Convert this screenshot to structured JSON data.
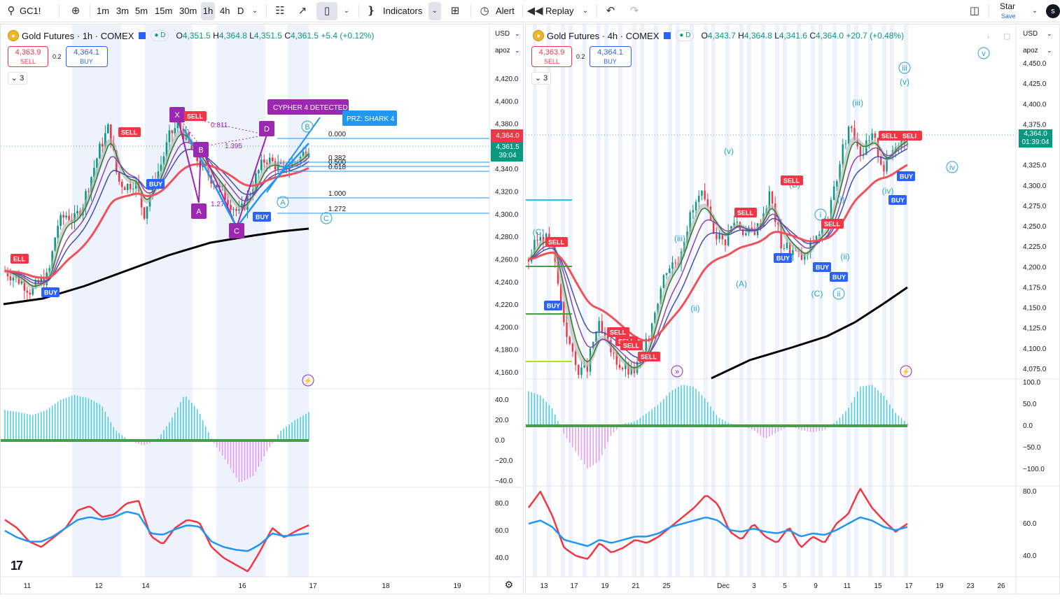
{
  "toolbar": {
    "symbol": "GC1!",
    "intervals": [
      "1m",
      "3m",
      "5m",
      "15m",
      "30m",
      "1h",
      "4h",
      "D"
    ],
    "selected_interval": "1h",
    "indicators_label": "Indicators",
    "alert_label": "Alert",
    "replay_label": "Replay",
    "star_label": "Star",
    "save_label": "Save",
    "avatar_letter": "s"
  },
  "pane1": {
    "title": "Gold Futures · 1h · COMEX",
    "ohlc": {
      "o": "4,351.5",
      "h": "4,364.8",
      "l": "4,351.5",
      "c": "4,361.5",
      "chg": "+5.4 (+0.12%)"
    },
    "sell_price": "4,363.9",
    "sell_label": "SELL",
    "buy_price": "4,364.1",
    "buy_label": "BUY",
    "spread": "0.2",
    "collapse_count": "3",
    "currency": "USD",
    "scale_label": "apoz",
    "price_ticks": [
      "4,420.0",
      "4,400.0",
      "4,380.0",
      "4,360.0",
      "4,340.0",
      "4,320.0",
      "4,300.0",
      "4,280.0",
      "4,260.0",
      "4,240.0",
      "4,220.0",
      "4,200.0",
      "4,180.0",
      "4,160.0"
    ],
    "last_price_red": "4,364.0",
    "last_price_green": "4,361.5",
    "countdown": "39:04",
    "osc_ticks": [
      "40.0",
      "20.0",
      "0.0",
      "−20.0",
      "−40.0"
    ],
    "rsi_ticks": [
      "80.0",
      "60.0",
      "40.0"
    ],
    "time_ticks": [
      "11",
      "12",
      "14",
      "16",
      "17",
      "18",
      "19"
    ],
    "fib_labels": [
      "0.000",
      "0.382",
      "0.500",
      "0.618",
      "1.000",
      "1.272"
    ],
    "harmonic_labels": [
      "X",
      "A",
      "B",
      "C",
      "D"
    ],
    "harmonic_ratios": [
      "0.811",
      "1.395",
      "1.27"
    ],
    "cypher_label": "CYPHER 4 DETECTED",
    "prz_label": "PRZ: SHARK 4",
    "wave_labels": [
      "B",
      "A",
      "C"
    ],
    "signals": {
      "sell": "SELL",
      "buy": "BUY",
      "sell_partial": "ELL"
    }
  },
  "pane2": {
    "title": "Gold Futures · 4h · COMEX",
    "ohlc": {
      "o": "4,343.7",
      "h": "4,364.8",
      "l": "4,341.6",
      "c": "4,364.0",
      "chg": "+20.7 (+0.48%)"
    },
    "sell_price": "4,363.9",
    "sell_label": "SELL",
    "buy_price": "4,364.1",
    "buy_label": "BUY",
    "spread": "0.2",
    "collapse_count": "3",
    "currency": "USD",
    "scale_label": "apoz",
    "price_ticks": [
      "4,450.0",
      "4,425.0",
      "4,400.0",
      "4,375.0",
      "4,350.0",
      "4,325.0",
      "4,300.0",
      "4,275.0",
      "4,250.0",
      "4,225.0",
      "4,200.0",
      "4,175.0",
      "4,150.0",
      "4,125.0",
      "4,100.0",
      "4,075.0"
    ],
    "last_price": "4,364.0",
    "countdown": "01:39:04",
    "osc_ticks": [
      "100.0",
      "50.0",
      "0.0",
      "−50.0",
      "−100.0"
    ],
    "rsi_ticks": [
      "80.0",
      "60.0",
      "40.0"
    ],
    "time_ticks": [
      "13",
      "17",
      "19",
      "21",
      "25",
      "Dec",
      "3",
      "5",
      "9",
      "11",
      "15",
      "17",
      "19",
      "23",
      "26"
    ],
    "wave_labels": [
      "(C)",
      "(v)",
      "(iii)",
      "(A)",
      "(ii)",
      "(B)",
      "(C)",
      "ii",
      "i",
      "(i)",
      "(ii)",
      "(iii)",
      "(iv)",
      "iv",
      "iii",
      "(v)",
      "v"
    ],
    "signals": {
      "sell": "SELL",
      "buy": "BUY",
      "sell_partial": "SELI"
    }
  },
  "colors": {
    "up": "#089981",
    "down": "#f23645",
    "accent": "#2962ff",
    "harmonic": "#9c27b0",
    "wave": "#26a6c9",
    "ema_black": "#000000",
    "ema_red": "#f0515a"
  }
}
